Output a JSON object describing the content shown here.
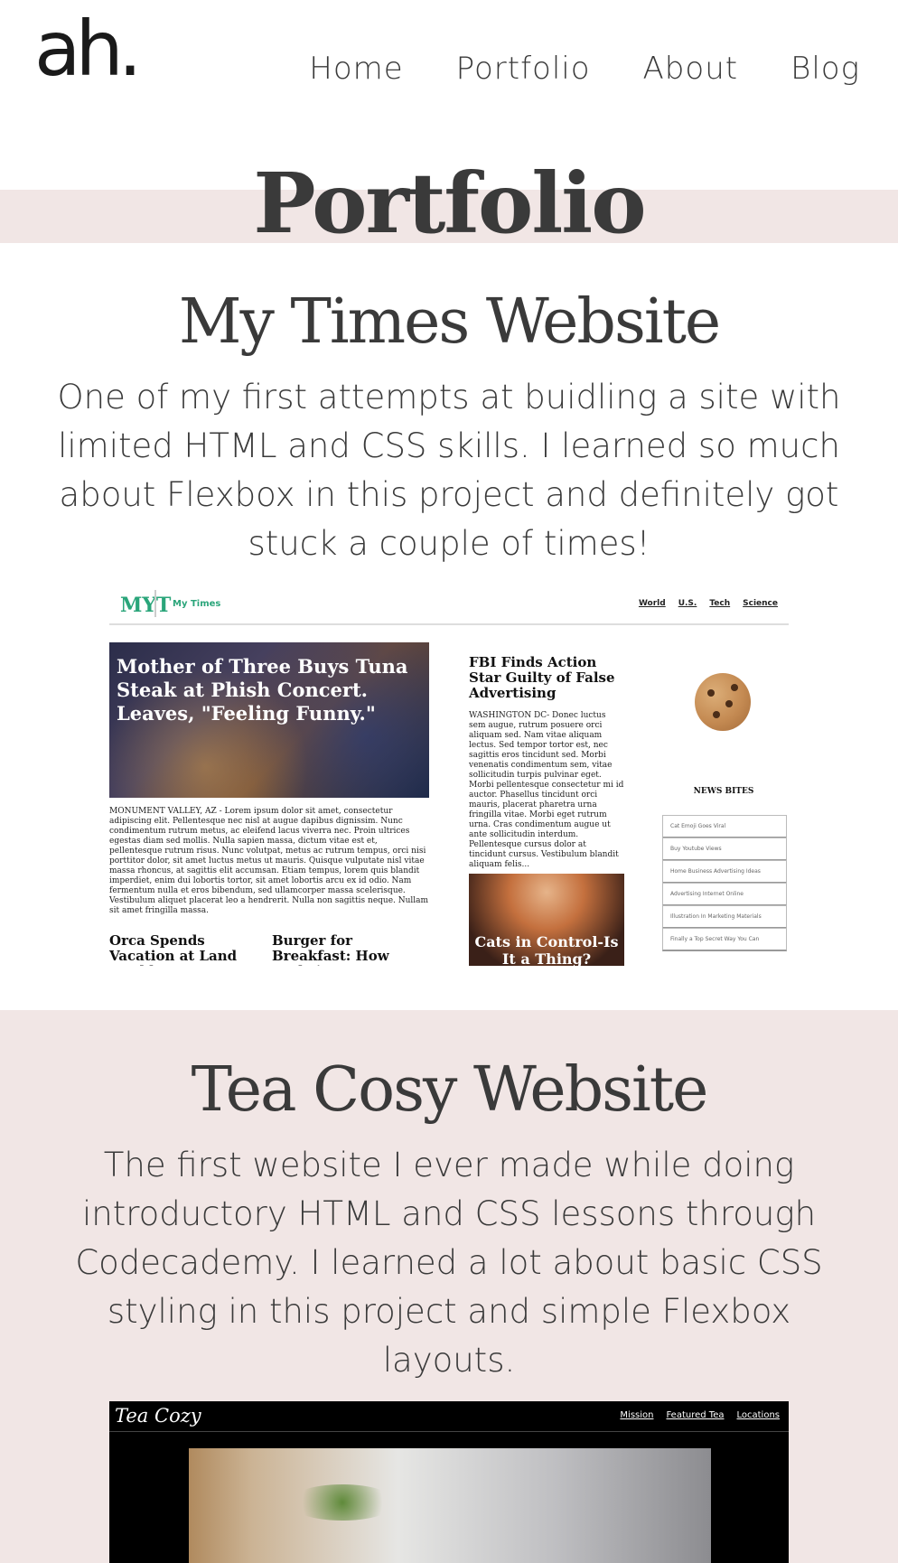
{
  "logo": "ah.",
  "nav": [
    "Home",
    "Portfolio",
    "About",
    "Blog"
  ],
  "page_title": "Portfolio",
  "projects": [
    {
      "title": "My Times Website",
      "description": "One of my first attempts at buidling a site with limited HTML and CSS skills. I learned so much about Flexbox in this project and definitely got stuck a couple of times!",
      "preview": {
        "logo": "MYT",
        "site_name": "My Times",
        "nav": [
          "World",
          "U.S.",
          "Tech",
          "Science"
        ],
        "headline": "Mother of Three Buys Tuna Steak at Phish Concert. Leaves, \"Feeling Funny.\"",
        "headline_body": "MONUMENT VALLEY, AZ - Lorem ipsum dolor sit amet, consectetur adipiscing elit. Pellentesque nec nisl at augue dapibus dignissim. Nunc condimentum rutrum metus, ac eleifend lacus viverra nec. Proin ultrices egestas diam sed mollis. Nulla sapien massa, dictum vitae est et, pellentesque rutrum risus. Nunc volutpat, metus ac rutrum tempus, orci nisi porttitor dolor, sit amet luctus metus ut mauris. Quisque vulputate nisl vitae massa rhoncus, at sagittis elit accumsan. Etiam tempus, lorem quis blandit imperdiet, enim dui lobortis tortor, sit amet lobortis arcu ex id odio. Nam fermentum nulla et eros bibendum, sed ullamcorper massa scelerisque. Vestibulum aliquet placerat leo a hendrerit. Nulla non sagittis neque. Nullam sit amet fringilla massa.",
        "sub_left": "Orca Spends Vacation at Land World Puget",
        "sub_right": "Burger for Breakfast: How Early is too",
        "col2_headline": "FBI Finds Action Star Guilty of False Advertising",
        "col2_body": "WASHINGTON DC- Donec luctus sem augue, rutrum posuere orci aliquam sed. Nam vitae aliquam lectus. Sed tempor tortor est, nec sagittis eros tincidunt sed. Morbi venenatis condimentum sem, vitae sollicitudin turpis pulvinar eget. Morbi pellentesque consectetur mi id auctor. Phasellus tincidunt orci mauris, placerat pharetra urna fringilla vitae. Morbi eget rutrum urna. Cras condimentum augue ut ante sollicitudin interdum. Pellentesque cursus dolor at tincidunt cursus. Vestibulum blandit aliquam felis...",
        "cat_headline": "Cats in Control-Is It a Thing?",
        "news_bites_title": "NEWS BITES",
        "news_bites": [
          "Cat Emoji Goes Viral",
          "Buy Youtube Views",
          "Home Business Advertising Ideas",
          "Advertising Internet Online",
          "Illustration In Marketing Materials",
          "Finally a Top Secret Way You Can"
        ]
      }
    },
    {
      "title": "Tea Cosy Website",
      "description": "The first website I ever made while doing introductory HTML and CSS lessons through Codecademy. I learned a lot about basic CSS styling in this project and simple Flexbox layouts.",
      "preview": {
        "logo": "Tea Cozy",
        "nav": [
          "Mission",
          "Featured Tea",
          "Locations"
        ]
      }
    }
  ],
  "colors": {
    "band": "#f1e6e5",
    "text": "#3a3a3a",
    "mytimes_accent": "#2aa57a"
  }
}
